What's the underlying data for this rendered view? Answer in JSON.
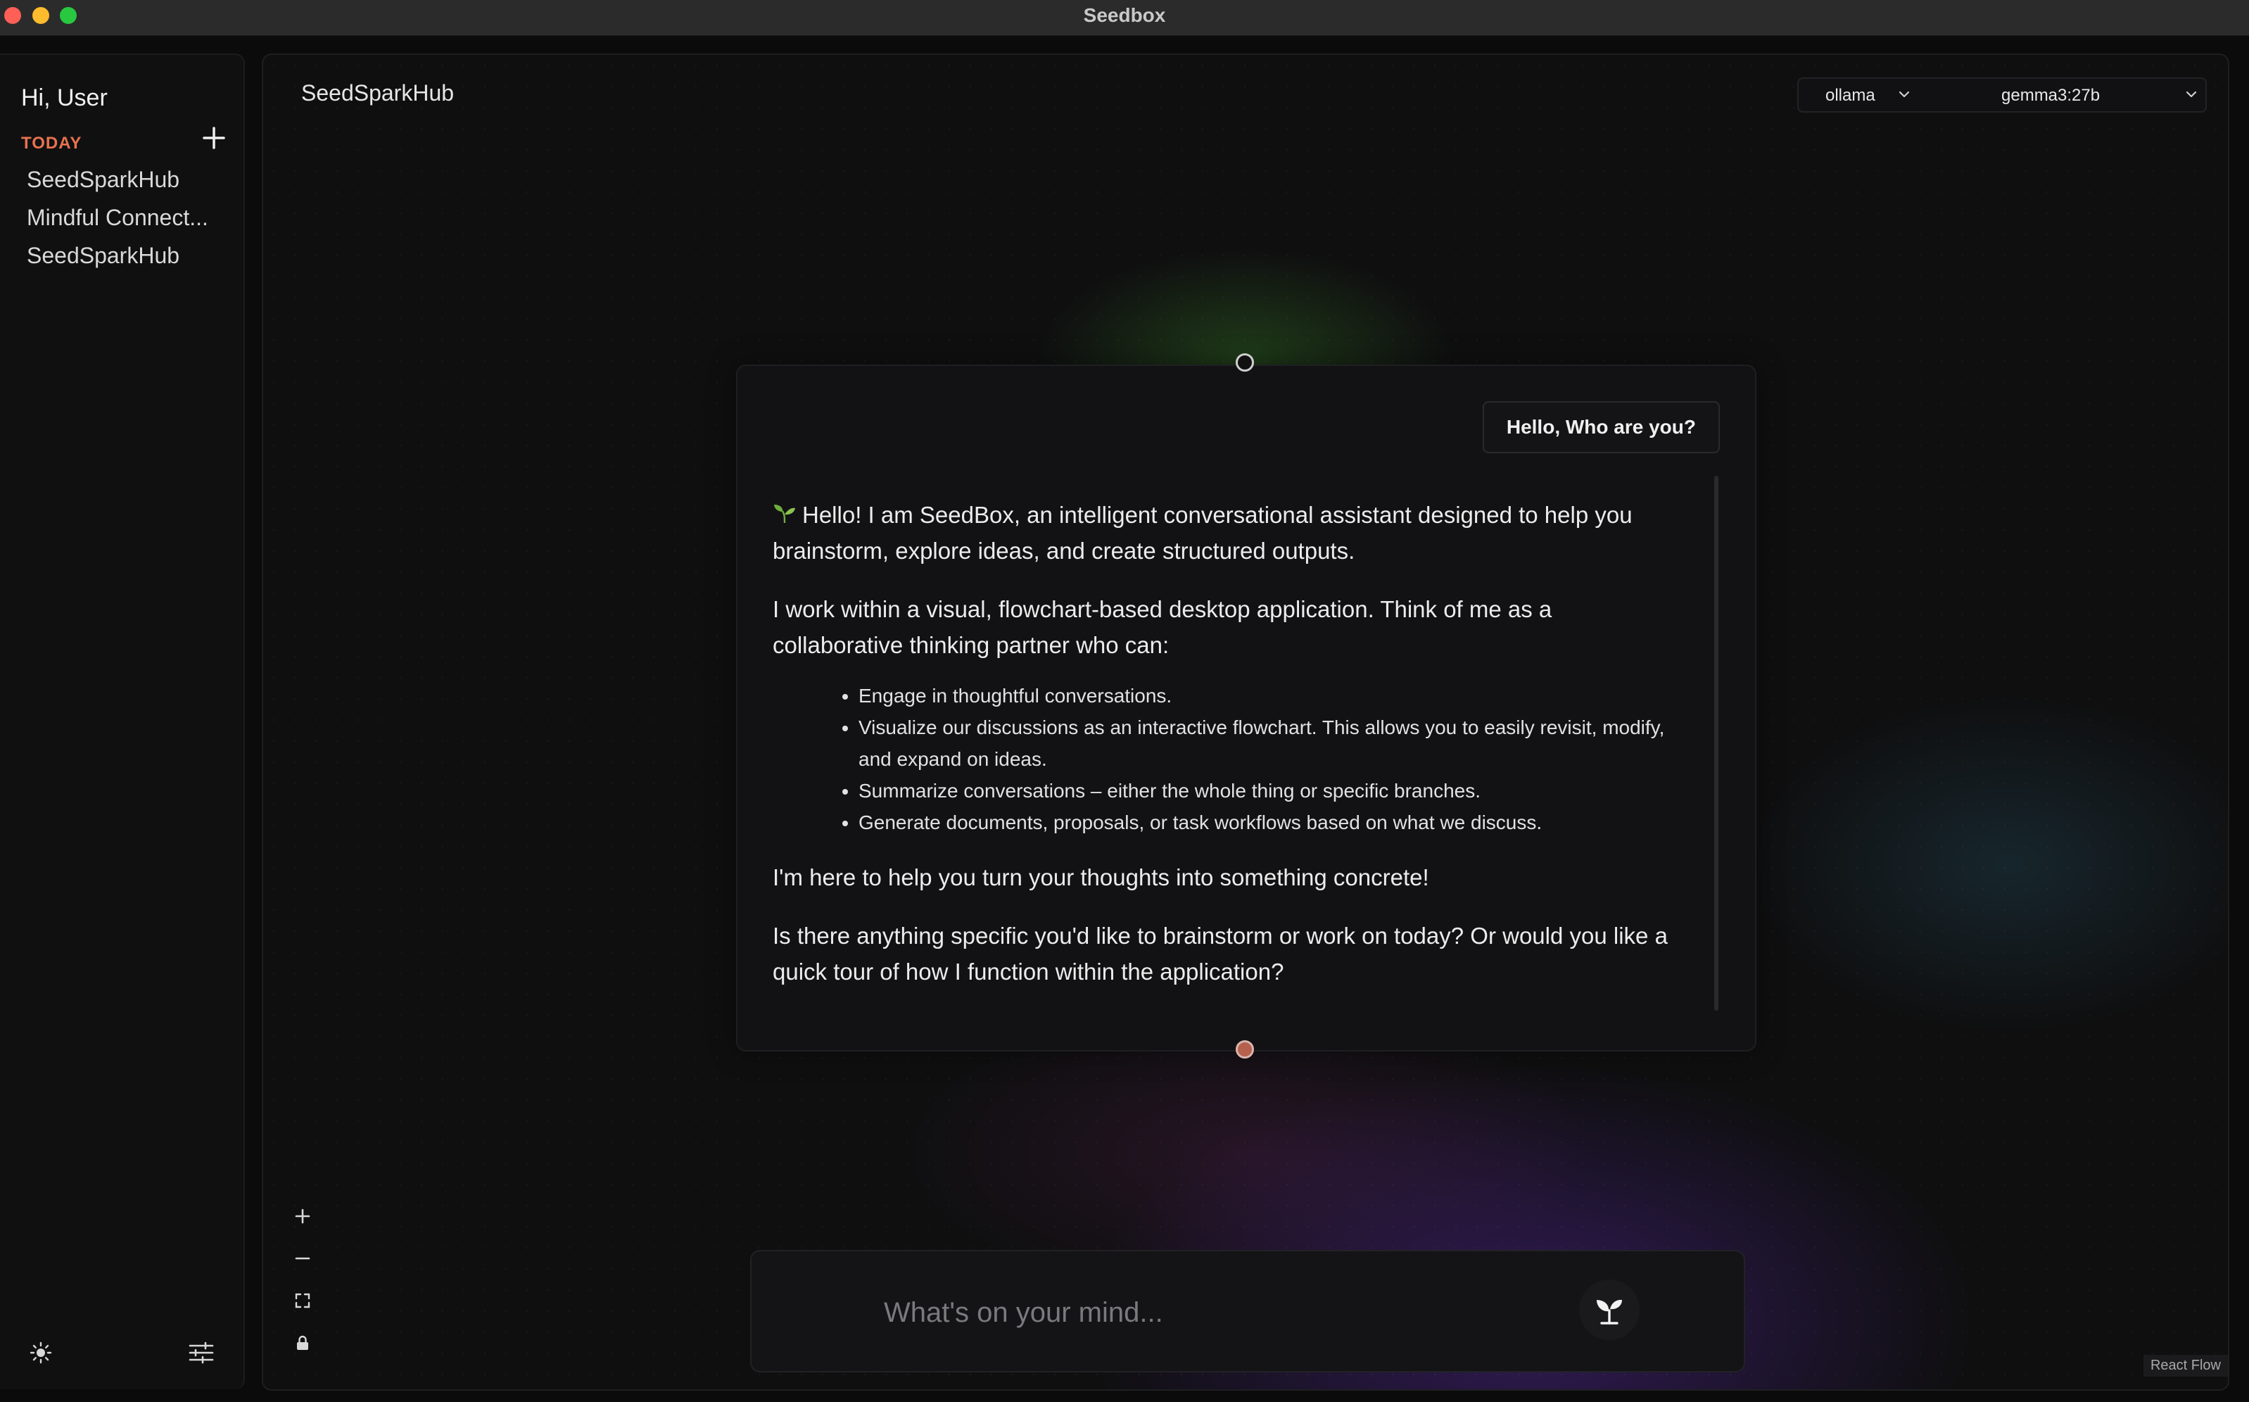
{
  "window": {
    "title": "Seedbox"
  },
  "sidebar": {
    "greeting": "Hi, User",
    "section_label": "TODAY",
    "chats": [
      {
        "label": "SeedSparkHub"
      },
      {
        "label": "Mindful Connect..."
      },
      {
        "label": "SeedSparkHub"
      }
    ]
  },
  "canvas": {
    "title": "SeedSparkHub",
    "provider": "ollama",
    "model": "gemma3:27b",
    "attribution": "React Flow"
  },
  "node": {
    "user_message": "Hello, Who are you?",
    "response": {
      "intro": "Hello! I am SeedBox, an intelligent conversational assistant designed to help you brainstorm, explore ideas, and create structured outputs.",
      "para2": "I work within a visual, flowchart-based desktop application. Think of me as a collaborative thinking partner who can:",
      "bullets": [
        "Engage in thoughtful conversations.",
        "Visualize our discussions as an interactive flowchart. This allows you to easily revisit, modify, and expand on ideas.",
        "Summarize conversations – either the whole thing or specific branches.",
        "Generate documents, proposals, or task workflows based on what we discuss."
      ],
      "para3": "I'm here to help you turn your thoughts into something concrete!",
      "para4": "Is there anything specific you'd like to brainstorm or work on today? Or would you like a quick tour of how I function within the application?"
    }
  },
  "input": {
    "placeholder": "What's on your mind..."
  },
  "colors": {
    "accent_orange": "#e8734f",
    "handle_bottom": "#b5614e",
    "sprout_green": "#6fae3c"
  }
}
